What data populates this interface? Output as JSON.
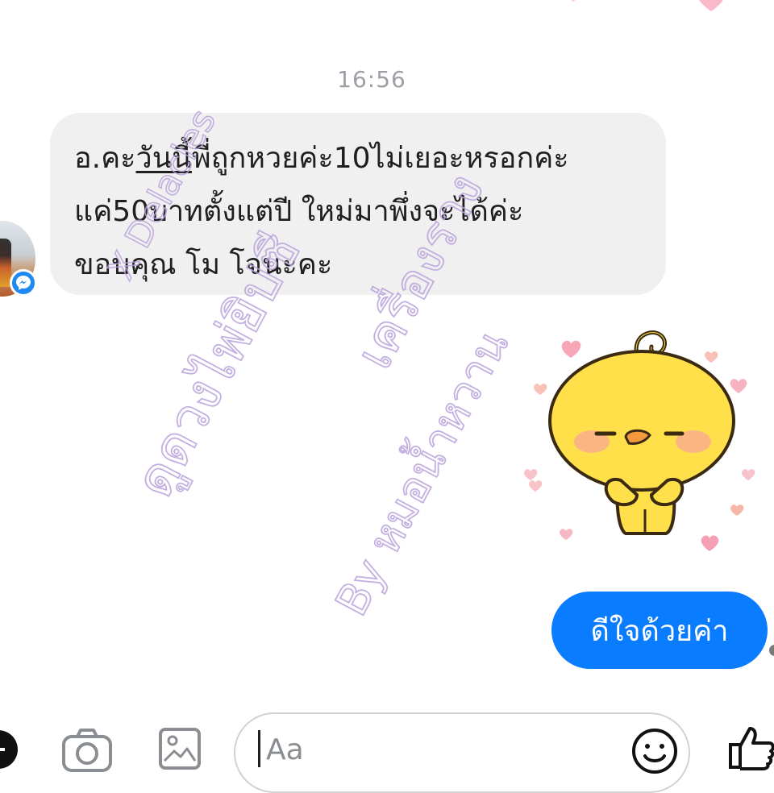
{
  "conversation": {
    "timestamp": "16:56",
    "incoming_message": {
      "line1_a": "อ.คะ",
      "line1_u": "วันนี้",
      "line1_b": "พี่ถูกหวยค่ะ10ไม่เยอะหรอกค่ะ",
      "line2": "แค่50บาทตั้งแต่ปี ใหม่มาพึ่งจะได้ค่ะ",
      "line3": "ขอบคุณ โม โจนะคะ"
    },
    "outgoing_message": "ดีใจด้วยค่า",
    "sticker": "yellow-chick-sticker-with-hearts"
  },
  "watermark": {
    "line1": "X Delacles",
    "line2": "เครื่องราง",
    "line3": "ดูดวงไพ่ยิปซี",
    "line4": "By หมอน้ำหวาน"
  },
  "composer": {
    "placeholder": "Aa",
    "icons": [
      "add-icon",
      "camera-icon",
      "gallery-icon",
      "emoji-icon",
      "thumbs-up-icon"
    ]
  },
  "colors": {
    "incoming_bubble": "#f0f0f0",
    "outgoing_bubble": "#0a7cff",
    "messenger_blue": "#1e88f3",
    "watermark": "#b9a3dc"
  }
}
